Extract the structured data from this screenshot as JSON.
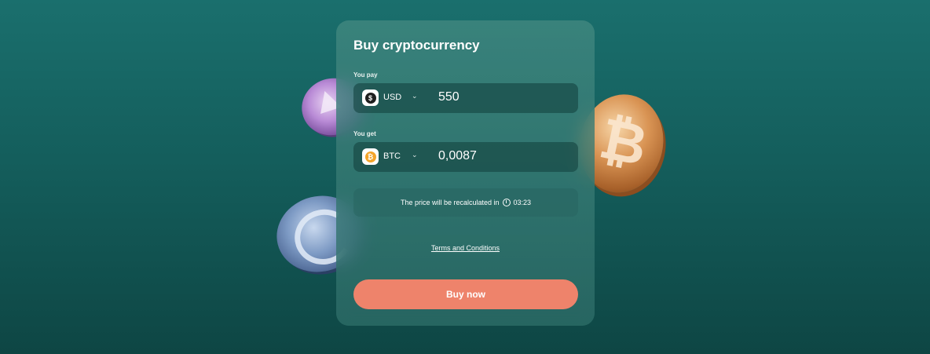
{
  "card": {
    "title": "Buy cryptocurrency",
    "pay": {
      "label": "You pay",
      "currency_code": "USD",
      "currency_symbol": "$",
      "amount": "550",
      "icon": "usd-icon"
    },
    "get": {
      "label": "You get",
      "currency_code": "BTC",
      "currency_symbol": "₿",
      "amount": "0,0087",
      "icon": "btc-icon"
    },
    "notice": {
      "text": "The price will be recalculated in",
      "timer": "03:23",
      "icon": "clock-icon"
    },
    "terms_link": "Terms and Conditions",
    "buy_button": "Buy now"
  },
  "decor": {
    "coins": [
      "ethereum-coin",
      "usdc-coin",
      "bitcoin-coin"
    ]
  },
  "colors": {
    "background": "#1a6f6d",
    "card": "#3a807a",
    "field": "#1a4a47",
    "accent_button": "#ee836b",
    "btc": "#f4a52a"
  }
}
